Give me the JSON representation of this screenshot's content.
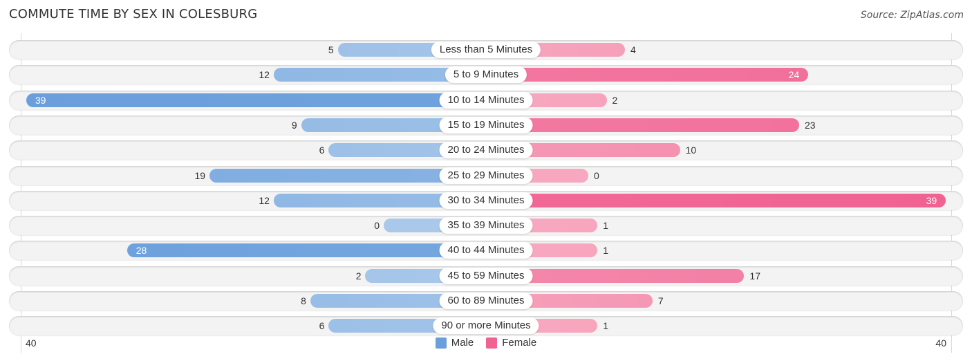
{
  "header": {
    "title": "COMMUTE TIME BY SEX IN COLESBURG",
    "source": "Source: ZipAtlas.com"
  },
  "colors": {
    "male": "#6a9fdc",
    "male_light": "#a9c8ea",
    "female": "#f06292",
    "female_light": "#f7a8c0"
  },
  "chart_data": {
    "type": "bar",
    "orientation": "horizontal-diverging",
    "title": "COMMUTE TIME BY SEX IN COLESBURG",
    "categories": [
      "Less than 5 Minutes",
      "5 to 9 Minutes",
      "10 to 14 Minutes",
      "15 to 19 Minutes",
      "20 to 24 Minutes",
      "25 to 29 Minutes",
      "30 to 34 Minutes",
      "35 to 39 Minutes",
      "40 to 44 Minutes",
      "45 to 59 Minutes",
      "60 to 89 Minutes",
      "90 or more Minutes"
    ],
    "series": [
      {
        "name": "Male",
        "values": [
          5,
          12,
          39,
          9,
          6,
          19,
          12,
          0,
          28,
          2,
          8,
          6
        ]
      },
      {
        "name": "Female",
        "values": [
          4,
          24,
          2,
          23,
          10,
          0,
          39,
          1,
          1,
          17,
          7,
          1
        ]
      }
    ],
    "axis": {
      "left_label": "40",
      "right_label": "40",
      "max": 40
    },
    "legend": {
      "position": "bottom-center",
      "items": [
        "Male",
        "Female"
      ]
    },
    "grid": false
  }
}
